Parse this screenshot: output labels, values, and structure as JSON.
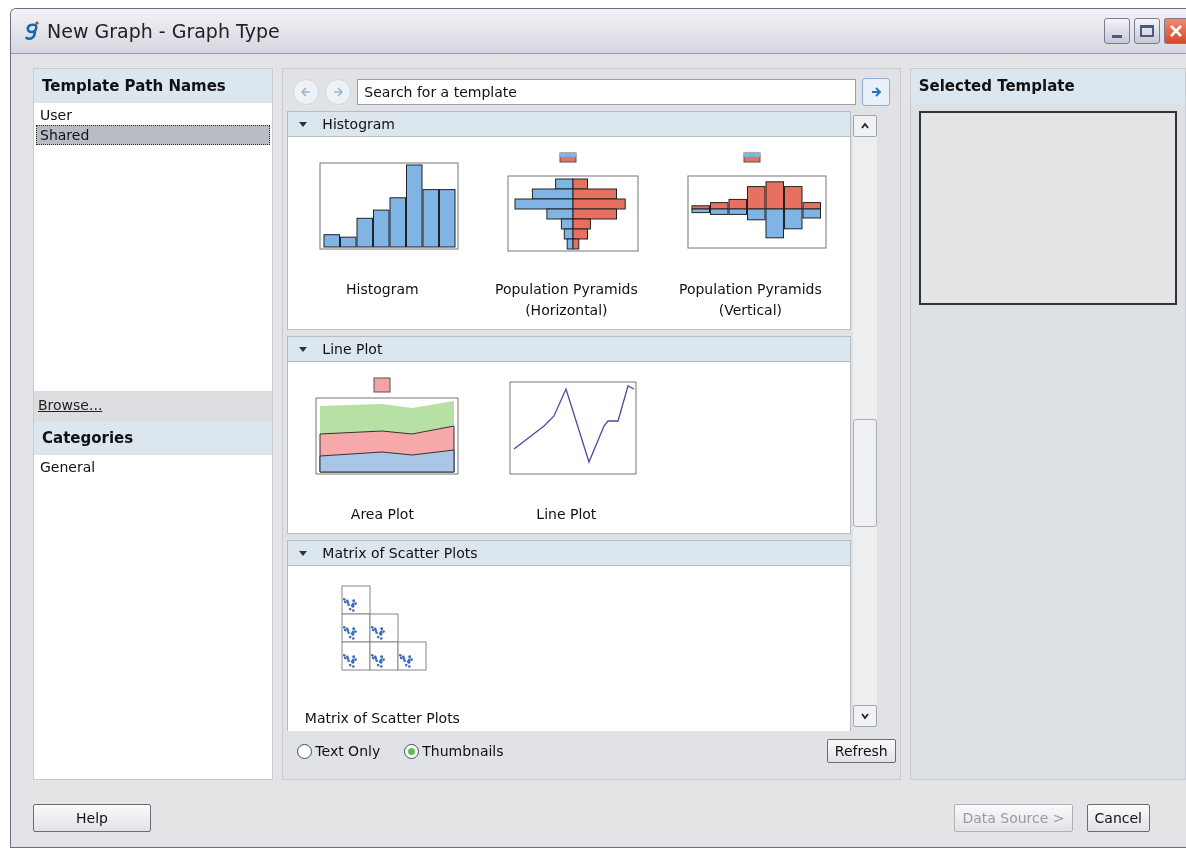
{
  "window": {
    "title": "New Graph - Graph Type"
  },
  "template_paths": {
    "heading": "Template Path Names",
    "items": [
      {
        "label": "User",
        "selected": false
      },
      {
        "label": "Shared",
        "selected": true
      }
    ],
    "browse_link": "Browse..."
  },
  "categories": {
    "heading": "Categories",
    "items": [
      {
        "label": "General",
        "selected": false
      }
    ]
  },
  "search": {
    "placeholder": "Search for a template"
  },
  "groups": [
    {
      "title": "Histogram",
      "expanded": true,
      "templates": [
        {
          "label": "Histogram",
          "kind": "histogram"
        },
        {
          "label": "Population Pyramids (Horizontal)",
          "kind": "pyramid_h"
        },
        {
          "label": "Population Pyramids (Vertical)",
          "kind": "pyramid_v"
        }
      ]
    },
    {
      "title": "Line Plot",
      "expanded": true,
      "templates": [
        {
          "label": "Area Plot",
          "kind": "area"
        },
        {
          "label": "Line Plot",
          "kind": "line"
        }
      ]
    },
    {
      "title": "Matrix of Scatter Plots",
      "expanded": true,
      "templates": [
        {
          "label": "Matrix of Scatter Plots",
          "kind": "scatter_matrix"
        }
      ]
    }
  ],
  "view_modes": [
    {
      "label": "Text Only",
      "selected": false
    },
    {
      "label": "Thumbnails",
      "selected": true
    }
  ],
  "refresh_button": "Refresh",
  "selected_template": {
    "heading": "Selected Template"
  },
  "buttons": [
    {
      "label": "Help",
      "kind": "help",
      "disabled": false
    },
    {
      "label": "Data Source >",
      "kind": "next",
      "disabled": true
    },
    {
      "label": "Cancel",
      "kind": "cancel",
      "disabled": false
    }
  ]
}
